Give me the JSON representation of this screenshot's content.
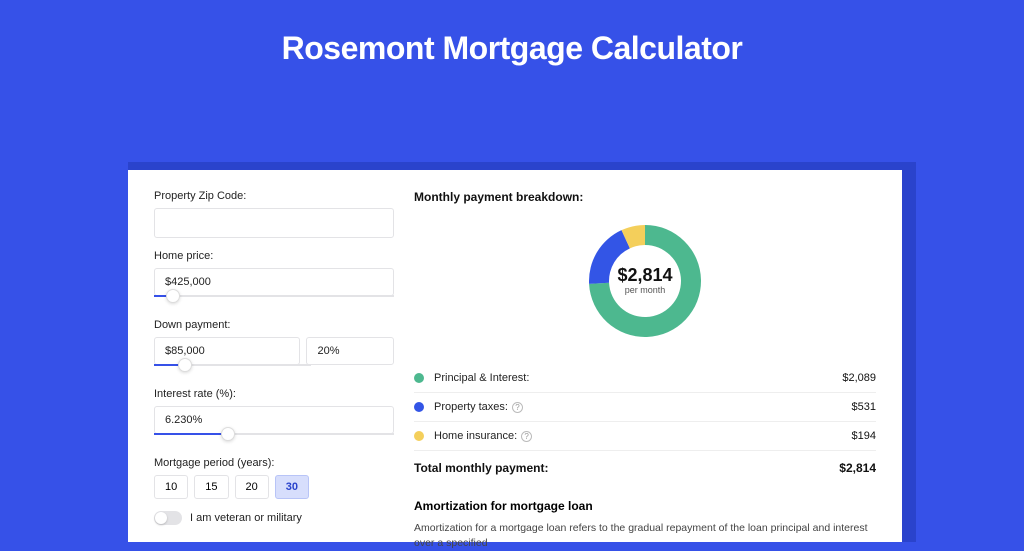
{
  "page": {
    "title": "Rosemont Mortgage Calculator"
  },
  "form": {
    "zip_label": "Property Zip Code:",
    "zip_value": "",
    "home_price_label": "Home price:",
    "home_price_value": "$425,000",
    "home_price_slider_pct": 8,
    "down_payment_label": "Down payment:",
    "down_payment_value": "$85,000",
    "down_payment_pct_value": "20%",
    "down_payment_slider_pct": 20,
    "interest_label": "Interest rate (%):",
    "interest_value": "6.230%",
    "interest_slider_pct": 31,
    "period_label": "Mortgage period (years):",
    "period_options": [
      "10",
      "15",
      "20",
      "30"
    ],
    "period_selected": "30",
    "veteran_label": "I am veteran or military",
    "veteran_on": false
  },
  "breakdown": {
    "title": "Monthly payment breakdown:",
    "center_amount": "$2,814",
    "center_sub": "per month",
    "items": [
      {
        "label": "Principal & Interest:",
        "amount": "$2,089",
        "color": "#4db88f",
        "pct": 74.2,
        "tooltip": false
      },
      {
        "label": "Property taxes:",
        "amount": "$531",
        "color": "#3355e6",
        "pct": 18.9,
        "tooltip": true
      },
      {
        "label": "Home insurance:",
        "amount": "$194",
        "color": "#f4cf5b",
        "pct": 6.9,
        "tooltip": true
      }
    ],
    "total_label": "Total monthly payment:",
    "total_amount": "$2,814"
  },
  "amortization": {
    "title": "Amortization for mortgage loan",
    "text": "Amortization for a mortgage loan refers to the gradual repayment of the loan principal and interest over a specified"
  },
  "chart_data": {
    "type": "pie",
    "title": "Monthly payment breakdown",
    "series": [
      {
        "name": "Principal & Interest",
        "value": 2089,
        "color": "#4db88f"
      },
      {
        "name": "Property taxes",
        "value": 531,
        "color": "#3355e6"
      },
      {
        "name": "Home insurance",
        "value": 194,
        "color": "#f4cf5b"
      }
    ],
    "total": 2814,
    "center_label": "$2,814 per month",
    "donut_inner_radius_ratio": 0.62
  }
}
